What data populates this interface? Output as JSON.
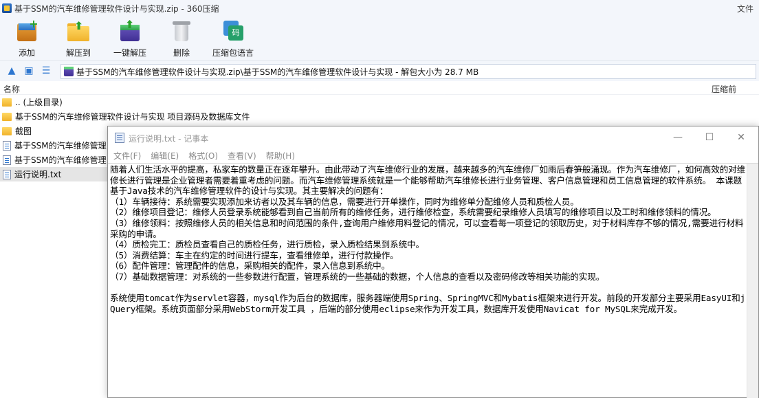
{
  "app": {
    "title": "基于SSM的汽车维修管理软件设计与实现.zip - 360压缩",
    "file_menu": "文件"
  },
  "toolbar": {
    "add": "添加",
    "extract_to": "解压到",
    "one_click_extract": "一键解压",
    "delete": "删除",
    "archive_language": "压缩包语言",
    "lang_glyph": "码"
  },
  "addressbar": {
    "path": "基于SSM的汽车维修管理软件设计与实现.zip\\基于SSM的汽车维修管理软件设计与实现 - 解包大小为 28.7 MB"
  },
  "filelist": {
    "col_name": "名称",
    "col_compressed": "压缩前",
    "rows": [
      {
        "name": ".. (上级目录)",
        "type": "folder"
      },
      {
        "name": "基于SSM的汽车维修管理软件设计与实现 项目源码及数据库文件",
        "type": "folder"
      },
      {
        "name": "截图",
        "type": "folder"
      },
      {
        "name": "基于SSM的汽车维修管理",
        "type": "doc"
      },
      {
        "name": "基于SSM的汽车维修管理",
        "type": "doc"
      },
      {
        "name": "运行说明.txt",
        "type": "doc",
        "selected": true
      }
    ]
  },
  "notepad": {
    "title": "运行说明.txt - 记事本",
    "menu": [
      "文件(F)",
      "编辑(E)",
      "格式(O)",
      "查看(V)",
      "帮助(H)"
    ],
    "minimize": "—",
    "maximize": "☐",
    "close": "✕",
    "content": "随着人们生活水平的提高，私家车的数量正在逐年攀升。由此带动了汽车维修行业的发展，越来越多的汽车维修厂如雨后春笋般涌现。作为汽车维修厂，如何高效的对维修长进行管理是企业管理者需要着重考虑的问题。而汽车维修管理系统就是一个能够帮助汽车维修长进行业务管理、客户信息管理和员工信息管理的软件系统。 本课题基于Java技术的汽车维修管理软件的设计与实现。其主要解决的问题有：\n（1）车辆接待：系统需要实现添加来访者以及其车辆的信息，需要进行开单操作，同时为维修单分配维修人员和质检人员。\n（2）维修项目登记：维修人员登录系统能够看到自己当前所有的维修任务，进行维修检查，系统需要纪录维修人员填写的维修项目以及工时和维修领料的情况。\n（3）维修领料：按照维修人员的相关信息和时间范围的条件,查询用户维修用料登记的情况，可以查看每一项登记的领取历史，对于材料库存不够的情况,需要进行材料采购的申请。\n（4）质检完工：质检员查看自己的质检任务，进行质检，录入质检结果到系统中。\n（5）消费结算：车主在约定的时间进行提车，查看维修单，进行付款操作。\n（6）配件管理：管理配件的信息，采购相关的配件，录入信息到系统中。\n（7）基础数据管理：对系统的一些参数进行配置，管理系统的一些基础的数据，个人信息的查看以及密码修改等相关功能的实现。\n\n系统使用tomcat作为servlet容器，mysql作为后台的数据库，服务器端使用Spring、SpringMVC和Mybatis框架来进行开发。前段的开发部分主要采用EasyUI和jQuery框架。系统页面部分采用WebStorm开发工具 ，后端的部分使用eclipse来作为开发工具，数据库开发使用Navicat for MySQL来完成开发。"
  }
}
